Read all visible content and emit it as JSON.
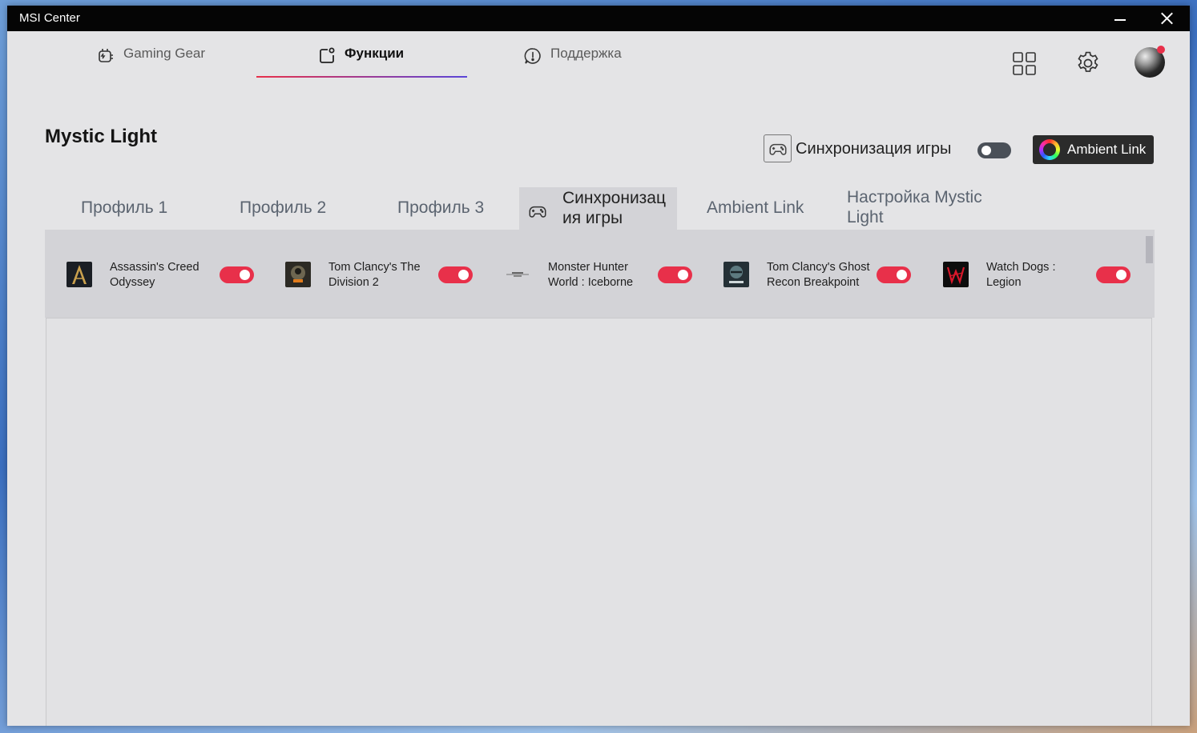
{
  "window": {
    "title": "MSI Center"
  },
  "nav": {
    "tabs": [
      {
        "label": "Gaming Gear",
        "icon": "gaming-gear-icon",
        "active": false
      },
      {
        "label": "Функции",
        "icon": "features-icon",
        "active": true
      },
      {
        "label": "Поддержка",
        "icon": "support-icon",
        "active": false
      }
    ],
    "right_icons": [
      "grid-icon",
      "gear-icon",
      "user-avatar"
    ]
  },
  "page": {
    "title": "Mystic Light",
    "game_sync_label": "Синхронизация игры",
    "game_sync_enabled": false,
    "ambient_button_label": "Ambient Link"
  },
  "subtabs": [
    {
      "label": "Профиль 1",
      "active": false
    },
    {
      "label": "Профиль 2",
      "active": false
    },
    {
      "label": "Профиль 3",
      "active": false
    },
    {
      "label": "Синхронизация игры",
      "active": true
    },
    {
      "label": "Ambient Link",
      "active": false
    },
    {
      "label": "Настройка Mystic Light",
      "active": false
    }
  ],
  "games": [
    {
      "name": "Assassin's Creed Odyssey",
      "enabled": true
    },
    {
      "name": "Tom Clancy's The Division 2",
      "enabled": true
    },
    {
      "name": "Monster Hunter World : Iceborne",
      "enabled": true
    },
    {
      "name": "Tom Clancy's Ghost Recon Breakpoint",
      "enabled": true
    },
    {
      "name": "Watch Dogs : Legion",
      "enabled": true
    }
  ],
  "colors": {
    "accent": "#e8304a",
    "titlebar": "#050505",
    "panel": "#d3d3d7",
    "background": "#e4e4e6"
  }
}
